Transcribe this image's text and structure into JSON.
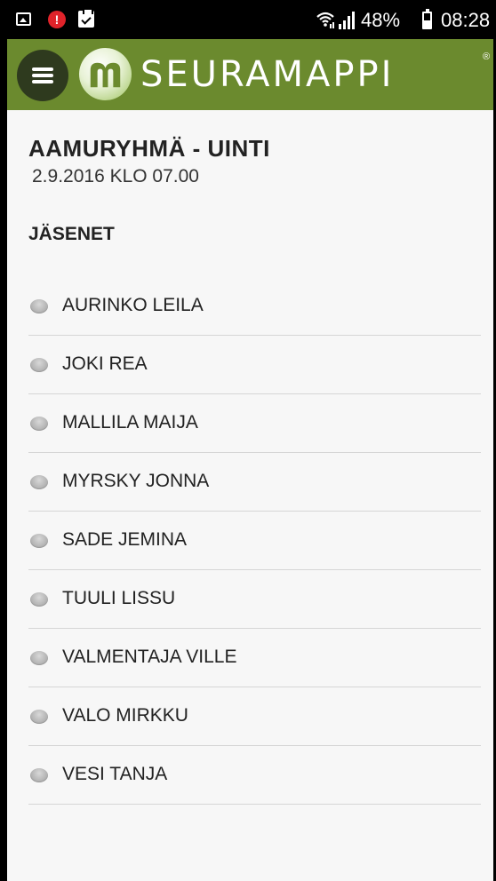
{
  "status_bar": {
    "battery_percent_text": "48%",
    "battery_level": 0.48,
    "time": "08:28",
    "alert_glyph": "!",
    "icons": [
      "gallery-icon",
      "alert-icon",
      "clipboard-check-icon",
      "wifi-icon",
      "signal-icon",
      "battery-icon"
    ]
  },
  "header": {
    "menu_icon": "hamburger-menu-icon",
    "logo_text_part1": "SEURA",
    "logo_text_part2": "MAPPI",
    "logo_registered": "®",
    "colors": {
      "header_bg": "#6b8a2e",
      "menu_button_bg": "#2e3a1e",
      "logo_text": "#ffffff"
    }
  },
  "event": {
    "title": "AAMURYHMÄ - UINTI",
    "date": "2.9.2016 KLO 07.00"
  },
  "members_section": {
    "header": "JÄSENET",
    "status_color": "#b5b5b5",
    "members": [
      {
        "name": "AURINKO LEILA"
      },
      {
        "name": "JOKI REA"
      },
      {
        "name": "MALLILA MAIJA"
      },
      {
        "name": "MYRSKY JONNA"
      },
      {
        "name": "SADE JEMINA"
      },
      {
        "name": "TUULI LISSU"
      },
      {
        "name": "VALMENTAJA VILLE"
      },
      {
        "name": "VALO MIRKKU"
      },
      {
        "name": "VESI TANJA"
      }
    ]
  }
}
